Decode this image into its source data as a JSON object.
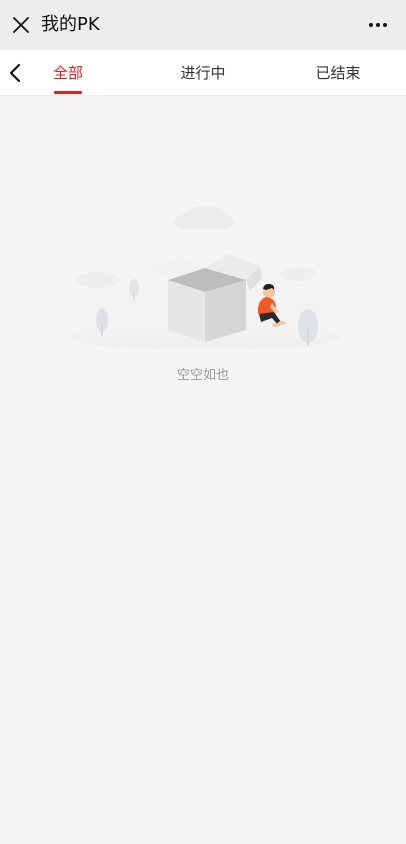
{
  "header": {
    "title": "我的PK",
    "close_icon": "close-icon",
    "more_icon": "more-icon"
  },
  "tabs": {
    "back_icon": "chevron-left-icon",
    "items": [
      {
        "label": "全部",
        "active": true
      },
      {
        "label": "进行中",
        "active": false
      },
      {
        "label": "已结束",
        "active": false
      }
    ],
    "active_color": "#e02020"
  },
  "empty_state": {
    "message": "空空如也",
    "illustration": "empty-box-illustration"
  }
}
